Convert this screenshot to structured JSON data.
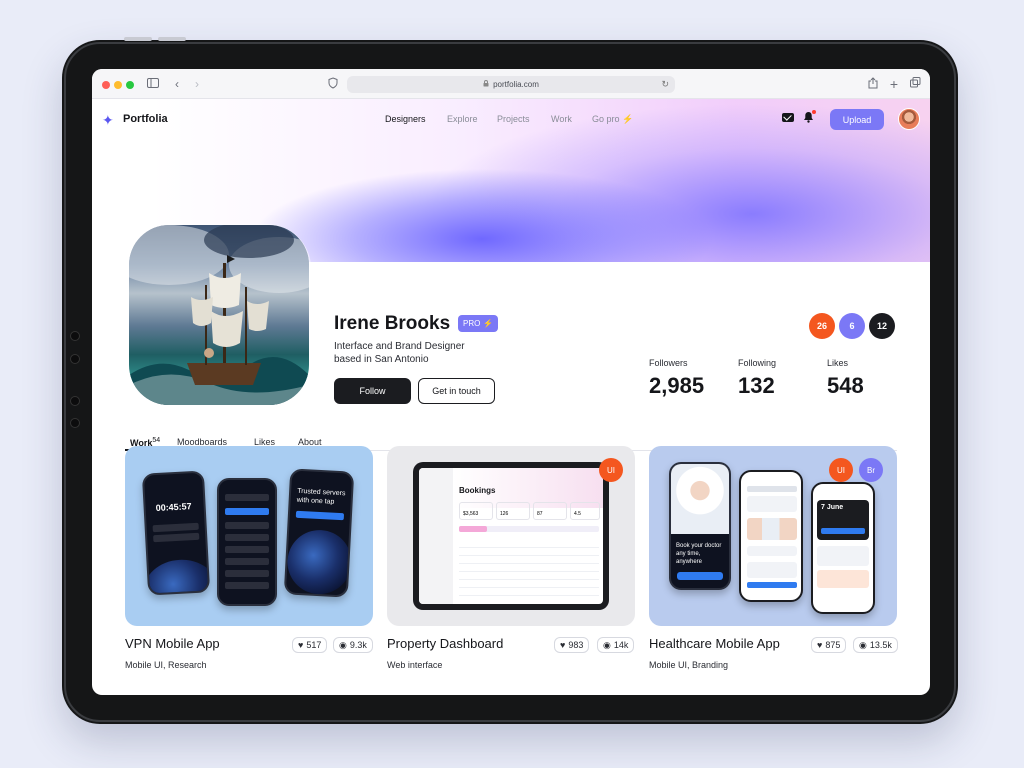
{
  "browser": {
    "url": "portfolia.com"
  },
  "nav": {
    "logo": "Portfolia",
    "links": [
      "Designers",
      "Explore",
      "Projects",
      "Work",
      "Go pro"
    ],
    "upload": "Upload"
  },
  "profile": {
    "name": "Irene Brooks",
    "pro_label": "PRO",
    "bio_line1": "Interface and Brand Designer",
    "bio_line2": "based in San Antonio",
    "follow": "Follow",
    "get_in_touch": "Get in touch",
    "badges": [
      {
        "value": "26",
        "color": "#f4571f"
      },
      {
        "value": "6",
        "color": "#7b78f6"
      },
      {
        "value": "12",
        "color": "#1b1c20"
      }
    ],
    "stats": [
      {
        "label": "Followers",
        "value": "2,985"
      },
      {
        "label": "Following",
        "value": "132"
      },
      {
        "label": "Likes",
        "value": "548"
      }
    ]
  },
  "tabs": [
    {
      "label": "Work",
      "count": "54"
    },
    {
      "label": "Moodboards"
    },
    {
      "label": "Likes"
    },
    {
      "label": "About"
    }
  ],
  "cards": [
    {
      "title": "VPN Mobile App",
      "subtitle": "Mobile UI, Research",
      "likes": "517",
      "views": "9.3k"
    },
    {
      "title": "Property Dashboard",
      "subtitle": "Web interface",
      "likes": "983",
      "views": "14k"
    },
    {
      "title": "Healthcare Mobile App",
      "subtitle": "Mobile UI, Branding",
      "likes": "875",
      "views": "13.5k"
    }
  ],
  "card_art": {
    "vpn_timer": "00:45:57",
    "vpn_promo": "Trusted servers with one tap",
    "dashboard_heading": "Bookings",
    "dashboard_metrics": [
      "$3,563",
      "126",
      "87",
      "4.5"
    ],
    "health_promo": "Book your doctor any time, anywhere",
    "health_date": "7 June",
    "tag_ui": "UI",
    "tag_br": "Br"
  },
  "colors": {
    "accent": "#7b78f6",
    "orange": "#f4571f",
    "dark": "#1b1c20"
  }
}
